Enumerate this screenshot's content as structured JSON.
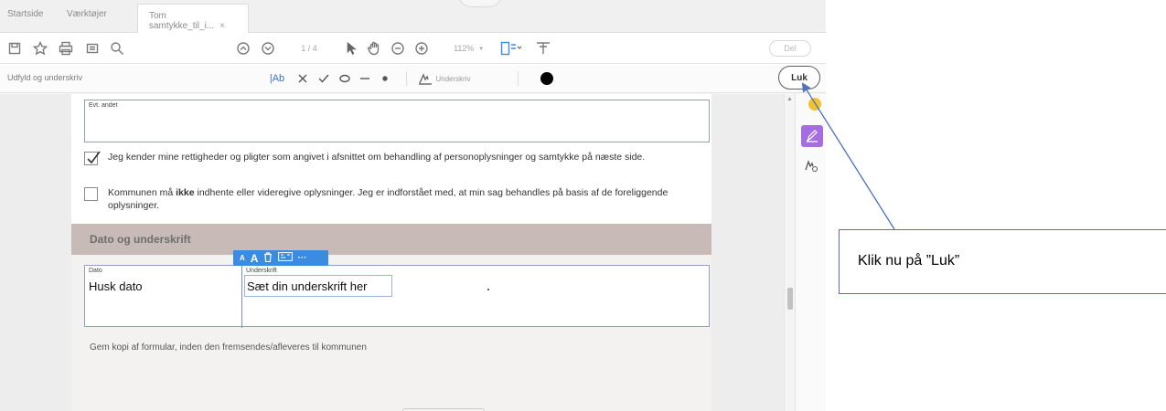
{
  "tabs": [
    {
      "label": "Startside"
    },
    {
      "label": "Værktøjer"
    },
    {
      "label": "Tom samtykke_til_i...",
      "close": "×"
    }
  ],
  "toolbar": {
    "page_indicator": "1 / 4",
    "zoom": "112%",
    "share": "Del"
  },
  "signbar": {
    "title": "Udfyld og underskriv",
    "text_tool": "|Ab",
    "sign_label": "Underskriv",
    "close_label": "Luk"
  },
  "form": {
    "other_label": "Evt. andet",
    "consent_text": "Jeg kender mine rettigheder og pligter som angivet i afsnittet om behandling af personoplysninger og samtykke på næste side.",
    "refuse_text_before": "Kommunen må ",
    "refuse_bold": "ikke",
    "refuse_text_after": " indhente eller videregive oplysninger. Jeg er indforstået med, at min sag behandles på basis af de foreliggende oplysninger.",
    "section_title": "Dato og underskrift",
    "date_label": "Dato",
    "date_value": "Husk dato",
    "signature_label": "Underskrift",
    "signature_value": "Sæt din underskrift her",
    "footer_note": "Gem kopi af formular, inden den fremsendes/afleveres til kommunen"
  },
  "mini_toolbar": {
    "small_a": "A",
    "large_a": "A",
    "more": "···"
  },
  "callout": {
    "text": "Klik nu på ”Luk”"
  },
  "colors": {
    "callout_border": "#4f71be",
    "section_bg": "#c8bab6",
    "accent_purple": "#a56ee0",
    "mini_toolbar": "#3b8be0"
  }
}
